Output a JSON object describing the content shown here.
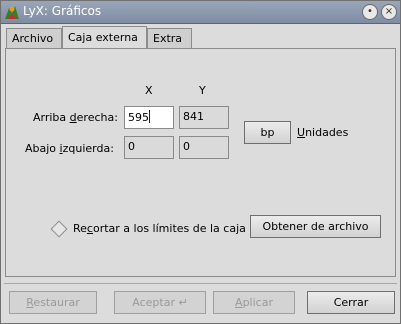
{
  "window": {
    "title": "LyX: Gráficos"
  },
  "tabs": [
    {
      "label": "Archivo"
    },
    {
      "label": "Caja externa"
    },
    {
      "label": "Extra"
    }
  ],
  "columns": {
    "x": "X",
    "y": "Y"
  },
  "rows": {
    "upper_right": {
      "label_pre": "Arriba ",
      "label_ul": "d",
      "label_post": "erecha:",
      "x": "595",
      "y": "841"
    },
    "lower_left": {
      "label_pre": "Abajo ",
      "label_ul": "i",
      "label_post": "zquierda:",
      "x": "0",
      "y": "0"
    }
  },
  "units": {
    "button": "bp",
    "label_ul": "U",
    "label_post": "nidades"
  },
  "clip": {
    "label_pre": "Re",
    "label_ul": "c",
    "label_post": "ortar a los límites de la caja"
  },
  "get_from_file": "Obtener de archivo",
  "footer": {
    "restore_ul": "R",
    "restore_post": "estaurar",
    "accept": "Aceptar",
    "apply_ul": "A",
    "apply_post": "plicar",
    "close": "Cerrar"
  }
}
